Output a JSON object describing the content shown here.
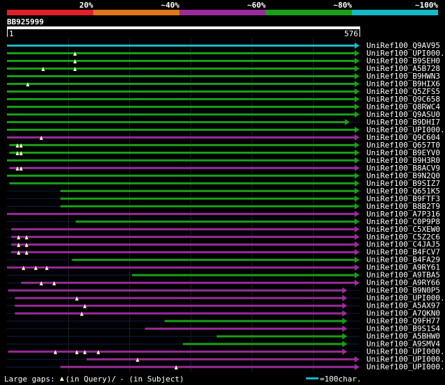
{
  "header": {
    "identity_scale": [
      {
        "label": "20%",
        "color": "#e0202a"
      },
      {
        "label": "~40%",
        "color": "#e07818"
      },
      {
        "label": "~60%",
        "color": "#9a2c9c"
      },
      {
        "label": "~80%",
        "color": "#18a018"
      },
      {
        "label": "~100%",
        "color": "#18b8c8"
      }
    ],
    "query_name": "BB925999",
    "ruler_start": "1",
    "ruler_end": "576"
  },
  "footer": {
    "gaps_prefix": "Large gaps:",
    "gaps_query": "(in Query)/",
    "gaps_subject": "- (in Subject)",
    "scale_text": "=100char."
  },
  "colors": {
    "background": "#000000",
    "cyan": "#18b8c8",
    "green": "#18a018",
    "purple": "#9a2c9c",
    "orange": "#e07818",
    "red": "#e0202a",
    "gap_marker": "#fffacd"
  },
  "hits": [
    {
      "name": "UniRef100_Q9AV95",
      "color": "cyan",
      "start": 1,
      "end": 576,
      "gaps": []
    },
    {
      "name": "UniRef100_UPI000..",
      "color": "green",
      "start": 1,
      "end": 576,
      "gaps": [
        [
          112,
          "q"
        ]
      ]
    },
    {
      "name": "UniRef100_B9SEH0",
      "color": "green",
      "start": 1,
      "end": 576,
      "gaps": [
        [
          112,
          "q"
        ]
      ]
    },
    {
      "name": "UniRef100_A5B728",
      "color": "green",
      "start": 1,
      "end": 576,
      "gaps": [
        [
          60,
          "q"
        ],
        [
          112,
          "q"
        ]
      ]
    },
    {
      "name": "UniRef100_B9HWN3",
      "color": "green",
      "start": 1,
      "end": 576,
      "gaps": []
    },
    {
      "name": "UniRef100_B9HIX6",
      "color": "green",
      "start": 1,
      "end": 576,
      "gaps": [
        [
          35,
          "q"
        ]
      ]
    },
    {
      "name": "UniRef100_Q5ZFS5",
      "color": "green",
      "start": 1,
      "end": 576,
      "gaps": []
    },
    {
      "name": "UniRef100_Q9C658",
      "color": "green",
      "start": 1,
      "end": 576,
      "gaps": []
    },
    {
      "name": "UniRef100_Q8RWC4",
      "color": "green",
      "start": 1,
      "end": 576,
      "gaps": []
    },
    {
      "name": "UniRef100_Q9ASU0",
      "color": "green",
      "start": 1,
      "end": 576,
      "gaps": []
    },
    {
      "name": "UniRef100_B9DHI7",
      "color": "green",
      "start": 1,
      "end": 560,
      "gaps": []
    },
    {
      "name": "UniRef100_UPI000..",
      "color": "green",
      "start": 1,
      "end": 576,
      "gaps": []
    },
    {
      "name": "UniRef100_Q9C604",
      "color": "purple",
      "start": 1,
      "end": 576,
      "gaps": [
        [
          57,
          "q"
        ]
      ]
    },
    {
      "name": "UniRef100_Q657T0",
      "color": "green",
      "start": 5,
      "end": 576,
      "gaps": [
        [
          18,
          "q"
        ],
        [
          24,
          "q"
        ]
      ]
    },
    {
      "name": "UniRef100_B9EYV0",
      "color": "green",
      "start": 5,
      "end": 576,
      "gaps": [
        [
          18,
          "q"
        ],
        [
          24,
          "q"
        ]
      ]
    },
    {
      "name": "UniRef100_B9H3R0",
      "color": "green",
      "start": 1,
      "end": 576,
      "gaps": []
    },
    {
      "name": "UniRef100_B8ACV9",
      "color": "purple",
      "start": 5,
      "end": 576,
      "gaps": [
        [
          18,
          "q"
        ],
        [
          24,
          "q"
        ]
      ]
    },
    {
      "name": "UniRef100_B9N2Q0",
      "color": "green",
      "start": 1,
      "end": 576,
      "gaps": []
    },
    {
      "name": "UniRef100_B9SIZ7",
      "color": "green",
      "start": 5,
      "end": 576,
      "gaps": []
    },
    {
      "name": "UniRef100_Q651K5",
      "color": "green",
      "start": 88,
      "end": 576,
      "gaps": []
    },
    {
      "name": "UniRef100_B9FTF3",
      "color": "green",
      "start": 88,
      "end": 576,
      "gaps": []
    },
    {
      "name": "UniRef100_B8B2T9",
      "color": "green",
      "start": 88,
      "end": 576,
      "gaps": []
    },
    {
      "name": "UniRef100_A7P316",
      "color": "purple",
      "start": 1,
      "end": 576,
      "gaps": []
    },
    {
      "name": "UniRef100_C0P9P8",
      "color": "green",
      "start": 113,
      "end": 576,
      "gaps": []
    },
    {
      "name": "UniRef100_C5XEW0",
      "color": "purple",
      "start": 8,
      "end": 576,
      "gaps": []
    },
    {
      "name": "UniRef100_C5Z2C6",
      "color": "purple",
      "start": 8,
      "end": 576,
      "gaps": [
        [
          20,
          "q"
        ],
        [
          33,
          "q"
        ]
      ]
    },
    {
      "name": "UniRef100_C4JAJ5",
      "color": "purple",
      "start": 8,
      "end": 576,
      "gaps": [
        [
          20,
          "q"
        ],
        [
          33,
          "q"
        ]
      ]
    },
    {
      "name": "UniRef100_B4FCV7",
      "color": "purple",
      "start": 8,
      "end": 576,
      "gaps": [
        [
          20,
          "q"
        ],
        [
          33,
          "q"
        ]
      ]
    },
    {
      "name": "UniRef100_B4FA29",
      "color": "green",
      "start": 107,
      "end": 576,
      "gaps": []
    },
    {
      "name": "UniRef100_A9RY61",
      "color": "purple",
      "start": 1,
      "end": 576,
      "gaps": [
        [
          28,
          "q"
        ],
        [
          48,
          "q"
        ],
        [
          66,
          "q"
        ]
      ]
    },
    {
      "name": "UniRef100_A9TBA5",
      "color": "green",
      "start": 205,
      "end": 576,
      "gaps": []
    },
    {
      "name": "UniRef100_A9RY66",
      "color": "purple",
      "start": 24,
      "end": 576,
      "gaps": [
        [
          57,
          "q"
        ],
        [
          78,
          "q"
        ]
      ]
    },
    {
      "name": "UniRef100_B9N0P5",
      "color": "purple",
      "start": 3,
      "end": 556,
      "gaps": []
    },
    {
      "name": "UniRef100_UPI000..",
      "color": "purple",
      "start": 14,
      "end": 556,
      "gaps": [
        [
          115,
          "q"
        ]
      ]
    },
    {
      "name": "UniRef100_A5AX97",
      "color": "purple",
      "start": 14,
      "end": 556,
      "gaps": [
        [
          128,
          "q"
        ]
      ]
    },
    {
      "name": "UniRef100_A7QKN0",
      "color": "purple",
      "start": 14,
      "end": 556,
      "gaps": [
        [
          123,
          "q"
        ]
      ]
    },
    {
      "name": "UniRef100_Q9FH77",
      "color": "green",
      "start": 258,
      "end": 556,
      "gaps": []
    },
    {
      "name": "UniRef100_B9S1S4",
      "color": "purple",
      "start": 226,
      "end": 556,
      "gaps": []
    },
    {
      "name": "UniRef100_A5BHW0",
      "color": "green",
      "start": 343,
      "end": 556,
      "gaps": []
    },
    {
      "name": "UniRef100_A9SMV4",
      "color": "green",
      "start": 288,
      "end": 556,
      "gaps": []
    },
    {
      "name": "UniRef100_UPI000..",
      "color": "purple",
      "start": 3,
      "end": 556,
      "gaps": [
        [
          80,
          "q"
        ],
        [
          115,
          "q"
        ],
        [
          128,
          "q"
        ],
        [
          150,
          "q"
        ]
      ]
    },
    {
      "name": "UniRef100_UPI000..",
      "color": "purple",
      "start": 131,
      "end": 576,
      "gaps": [
        [
          214,
          "q"
        ]
      ]
    },
    {
      "name": "UniRef100_UPI000..",
      "color": "purple",
      "start": 88,
      "end": 576,
      "gaps": [
        [
          277,
          "q"
        ]
      ]
    }
  ]
}
